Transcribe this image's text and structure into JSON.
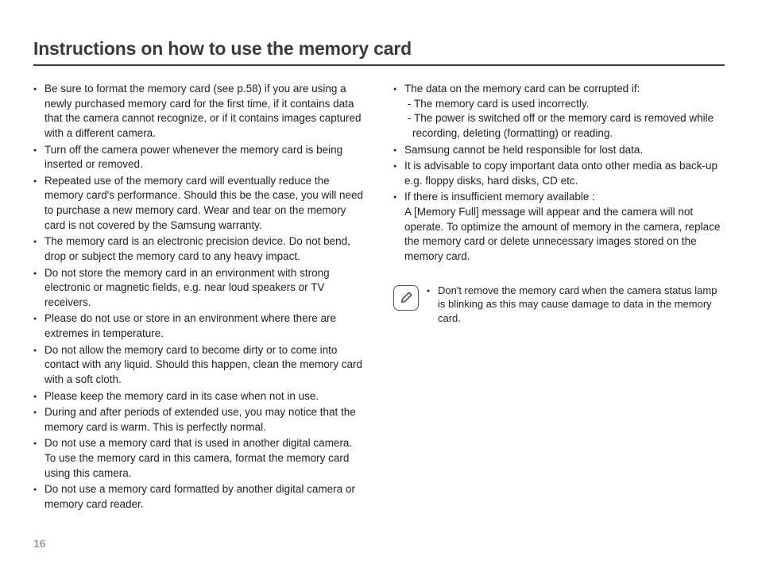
{
  "title": "Instructions on how to use the memory card",
  "page_number": "16",
  "col1": {
    "items": [
      {
        "text": "Be sure to format the memory card (see p.58) if you are using a newly purchased memory card for the first time, if it contains data that the camera cannot recognize, or if it contains images captured with a different camera."
      },
      {
        "text": "Turn off the camera power whenever the memory card is being inserted or removed."
      },
      {
        "text": "Repeated use of the memory card will eventually reduce the memory card's performance. Should this be the case, you will need to purchase a new memory card. Wear and tear on the memory card is not covered by the Samsung warranty."
      },
      {
        "text": "The memory card is an electronic precision device. Do not bend, drop or subject the memory card to any heavy impact."
      },
      {
        "text": "Do not store the memory card in an environment with strong electronic or magnetic fields, e.g. near loud speakers or TV receivers."
      },
      {
        "text": "Please do not use or store in an environment where there are extremes in temperature."
      },
      {
        "text": "Do not allow the memory card to become dirty or to come into contact with any liquid. Should this happen, clean the memory card with a soft cloth."
      },
      {
        "text": "Please keep the memory card in its case when not in use."
      },
      {
        "text": "During and after periods of extended use, you may notice that the memory card is warm. This is perfectly normal."
      },
      {
        "text": "Do not use a memory card that is used in another digital camera. To use the memory card in this camera, format the memory card using this camera."
      },
      {
        "text": "Do not use a memory card formatted by another digital camera or memory card reader."
      }
    ]
  },
  "col2": {
    "items": [
      {
        "text": "The data on the memory card can be corrupted if:",
        "subitems": [
          "- The memory card is used incorrectly.",
          "- The power is switched off or the memory card is removed while recording, deleting (formatting) or reading."
        ]
      },
      {
        "text": "Samsung cannot be held responsible for lost data."
      },
      {
        "text": "It is advisable to copy important data onto other media as back-up e.g. floppy disks, hard disks, CD etc."
      },
      {
        "text": "If there is insufficient memory available :",
        "cont": "A [Memory Full] message will appear and the camera will not operate. To optimize the amount of memory in the camera, replace the memory card or delete unnecessary images stored on the memory card."
      }
    ]
  },
  "note": {
    "icon": "note-icon",
    "items": [
      {
        "text": "Don't remove the memory card when the camera status lamp is blinking as this may cause damage to data in the memory card."
      }
    ]
  }
}
